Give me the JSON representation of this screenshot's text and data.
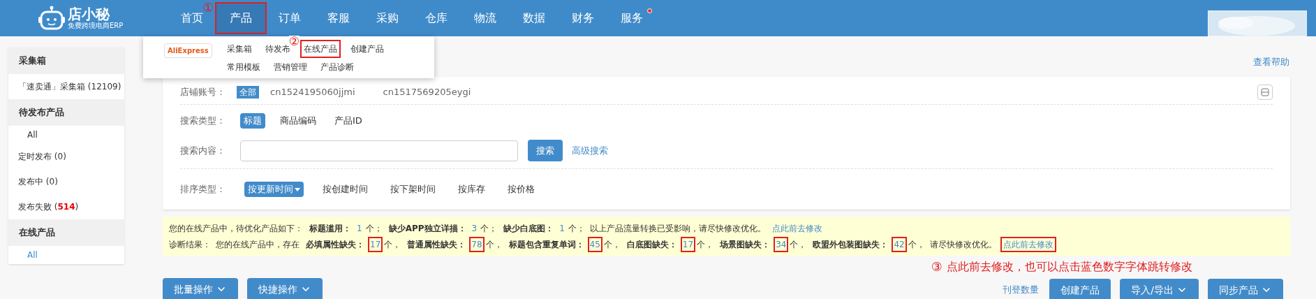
{
  "header": {
    "logo": {
      "name": "店小秘",
      "tagline": "免费跨境电商ERP"
    },
    "nav": [
      {
        "label": "首页",
        "selected": false,
        "highlighted": false
      },
      {
        "label": "产品",
        "selected": true,
        "highlighted": true,
        "annotation": "①"
      },
      {
        "label": "订单",
        "selected": false,
        "highlighted": false
      },
      {
        "label": "客服",
        "selected": false,
        "highlighted": false
      },
      {
        "label": "采购",
        "selected": false,
        "highlighted": false
      },
      {
        "label": "仓库",
        "selected": false,
        "highlighted": false
      },
      {
        "label": "物流",
        "selected": false,
        "highlighted": false
      },
      {
        "label": "数据",
        "selected": false,
        "highlighted": false
      },
      {
        "label": "财务",
        "selected": false,
        "highlighted": false
      },
      {
        "label": "服务",
        "selected": false,
        "highlighted": false,
        "badge": true
      }
    ]
  },
  "dropdown": {
    "platform": "AliExpress",
    "rows": [
      [
        {
          "label": "采集箱",
          "highlighted": false
        },
        {
          "label": "待发布",
          "highlighted": false
        },
        {
          "label": "在线产品",
          "highlighted": true,
          "annotation": "②"
        },
        {
          "label": "创建产品",
          "highlighted": false
        }
      ],
      [
        {
          "label": "常用模板",
          "highlighted": false
        },
        {
          "label": "营销管理",
          "highlighted": false
        },
        {
          "label": "产品诊断",
          "highlighted": false
        }
      ]
    ]
  },
  "sidebar": {
    "sections": [
      {
        "title": "采集箱",
        "items": [
          {
            "label": "「速卖通」采集箱 (12109)",
            "selected": false,
            "kind": "plain"
          }
        ]
      },
      {
        "title": "待发布产品",
        "items": [
          {
            "label": "All",
            "selected": false,
            "kind": "sub"
          },
          {
            "label": "定时发布 (0)",
            "selected": false,
            "kind": "plain"
          },
          {
            "label": "发布中 (0)",
            "selected": false,
            "kind": "plain"
          },
          {
            "label": "发布失败 (**514**)",
            "selected": false,
            "kind": "plain"
          }
        ]
      },
      {
        "title": "在线产品",
        "items": [
          {
            "label": "All",
            "selected": true,
            "kind": "sub"
          }
        ]
      }
    ]
  },
  "help_link": "查看帮助",
  "filters": {
    "store": {
      "label": "店铺账号：",
      "tag": "全部",
      "accounts": [
        "cn1524195060jjmi",
        "cn1517569205eygi"
      ]
    },
    "search_type": {
      "label": "搜索类型：",
      "options": [
        {
          "label": "标题",
          "selected": true
        },
        {
          "label": "商品编码",
          "selected": false
        },
        {
          "label": "产品ID",
          "selected": false
        }
      ]
    },
    "search_content": {
      "label": "搜索内容：",
      "button": "搜索",
      "advanced": "高级搜索"
    },
    "sort": {
      "label": "排序类型：",
      "options": [
        {
          "label": "按更新时间",
          "selected": true
        },
        {
          "label": "按创建时间",
          "selected": false
        },
        {
          "label": "按下架时间",
          "selected": false
        },
        {
          "label": "按库存",
          "selected": false
        },
        {
          "label": "按价格",
          "selected": false
        }
      ]
    }
  },
  "notice": {
    "lines": [
      [
        {
          "kind": "text",
          "text": "您的在线产品中，待优化产品如下："
        },
        {
          "kind": "bold",
          "text": "标题滥用："
        },
        {
          "kind": "number",
          "text": "1",
          "highlighted": false
        },
        {
          "kind": "text",
          "text": "个；"
        },
        {
          "kind": "bold",
          "text": "缺少APP独立详描："
        },
        {
          "kind": "number",
          "text": "3",
          "highlighted": false
        },
        {
          "kind": "text",
          "text": "个；"
        },
        {
          "kind": "bold",
          "text": "缺少白底图："
        },
        {
          "kind": "number",
          "text": "1",
          "highlighted": false
        },
        {
          "kind": "text",
          "text": "个；"
        },
        {
          "kind": "text",
          "text": "以上产品流量转换已受影响，请尽快修改优化。"
        },
        {
          "kind": "link",
          "text": "点此前去修改",
          "highlighted": false
        }
      ],
      [
        {
          "kind": "text",
          "text": "诊断结果："
        },
        {
          "kind": "text",
          "text": "您的在线产品中，存在"
        },
        {
          "kind": "bold",
          "text": "必填属性缺失："
        },
        {
          "kind": "number",
          "text": "17",
          "highlighted": true
        },
        {
          "kind": "text",
          "text": "个，"
        },
        {
          "kind": "bold",
          "text": "普通属性缺失："
        },
        {
          "kind": "number",
          "text": "78",
          "highlighted": true
        },
        {
          "kind": "text",
          "text": "个，"
        },
        {
          "kind": "bold",
          "text": "标题包含重复单词："
        },
        {
          "kind": "number",
          "text": "45",
          "highlighted": true
        },
        {
          "kind": "text",
          "text": "个，"
        },
        {
          "kind": "bold",
          "text": "白底图缺失："
        },
        {
          "kind": "number",
          "text": "17",
          "highlighted": true
        },
        {
          "kind": "text",
          "text": "个，"
        },
        {
          "kind": "bold",
          "text": "场景图缺失："
        },
        {
          "kind": "number",
          "text": "34",
          "highlighted": true
        },
        {
          "kind": "text",
          "text": "个，"
        },
        {
          "kind": "bold",
          "text": "欧盟外包装图缺失："
        },
        {
          "kind": "number",
          "text": "42",
          "highlighted": true
        },
        {
          "kind": "text",
          "text": "个，"
        },
        {
          "kind": "text",
          "text": "请尽快修改优化。"
        },
        {
          "kind": "link",
          "text": "点此前去修改",
          "highlighted": true
        }
      ]
    ],
    "annotation": {
      "mark": "③",
      "text": "点此前去修改，也可以点击蓝色数字字体跳转修改"
    }
  },
  "actions": {
    "left": [
      {
        "label": "批量操作",
        "dropdown": true
      },
      {
        "label": "快捷操作",
        "dropdown": true
      }
    ],
    "link": "刊登数量",
    "right": [
      {
        "label": "创建产品",
        "dropdown": false
      },
      {
        "label": "导入/导出",
        "dropdown": true
      },
      {
        "label": "同步产品",
        "dropdown": true
      }
    ]
  }
}
